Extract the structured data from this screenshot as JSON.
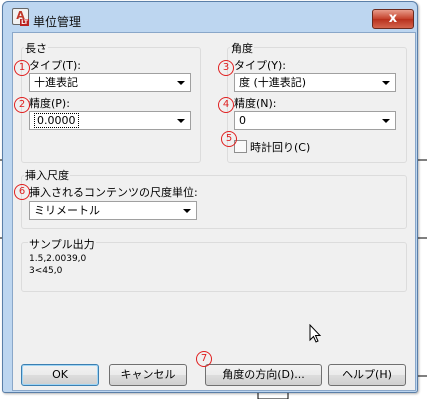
{
  "window": {
    "title": "単位管理",
    "app_icon_text": "A",
    "app_icon_sub": "LT",
    "close_label": "x"
  },
  "length": {
    "group_title": "長さ",
    "type_label": "タイプ(T):",
    "type_value": "十進表記",
    "precision_label": "精度(P):",
    "precision_value": "0.0000"
  },
  "angle": {
    "group_title": "角度",
    "type_label": "タイプ(Y):",
    "type_value": "度 (十進表記)",
    "precision_label": "精度(N):",
    "precision_value": "0",
    "clockwise_label": "時計回り(C)",
    "clockwise_checked": false
  },
  "insertion": {
    "group_title": "挿入尺度",
    "units_label": "挿入されるコンテンツの尺度単位:",
    "units_value": "ミリメートル"
  },
  "sample": {
    "group_title": "サンプル出力",
    "line1": "1.5,2.0039,0",
    "line2": "3<45,0"
  },
  "buttons": {
    "ok": "OK",
    "cancel": "キャンセル",
    "direction": "角度の方向(D)...",
    "help": "ヘルプ(H)"
  },
  "markers": [
    "1",
    "2",
    "3",
    "4",
    "5",
    "6",
    "7"
  ]
}
